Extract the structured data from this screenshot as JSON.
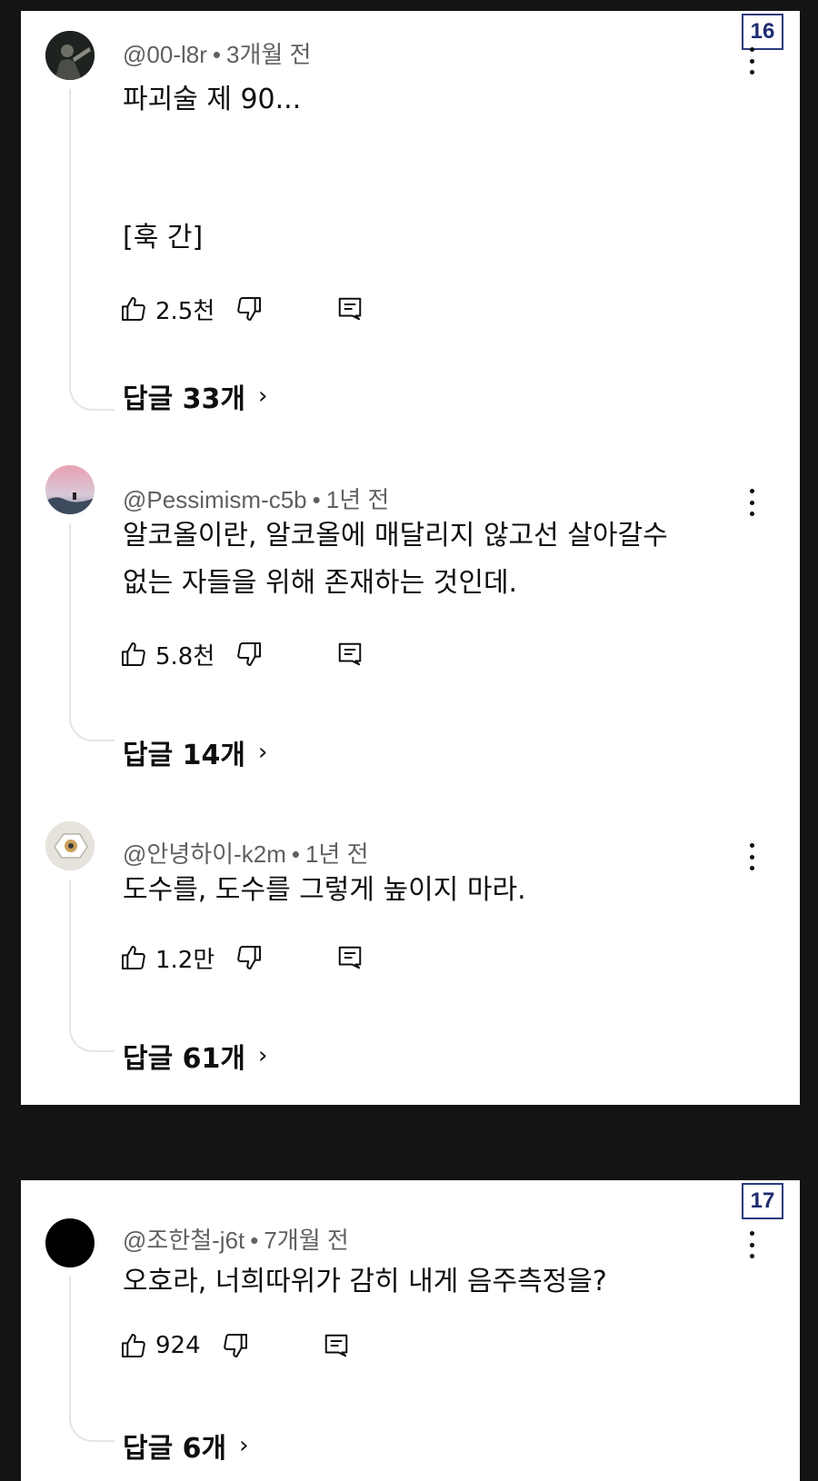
{
  "panels": [
    {
      "badge": "16",
      "comments": [
        {
          "handle": "@00-l8r",
          "time": "3개월 전",
          "lines": [
            "파괴술 제 90...",
            "",
            "[훅 간]"
          ],
          "likes": "2.5천",
          "replies": "답글 33개"
        },
        {
          "handle": "@Pessimism-c5b",
          "time": "1년 전",
          "lines": [
            "알코올이란, 알코올에 매달리지 않고선 살아갈수",
            "없는 자들을 위해 존재하는 것인데."
          ],
          "likes": "5.8천",
          "replies": "답글 14개"
        },
        {
          "handle": "@안녕하이-k2m",
          "time": "1년 전",
          "lines": [
            "도수를, 도수를 그렇게 높이지 마라."
          ],
          "likes": "1.2만",
          "replies": "답글 61개"
        }
      ]
    },
    {
      "badge": "17",
      "comments": [
        {
          "handle": "@조한철-j6t",
          "time": "7개월 전",
          "lines": [
            "오호라, 너희따위가 감히 내게 음주측정을?"
          ],
          "likes": "924",
          "replies": "답글 6개"
        }
      ]
    }
  ],
  "separator": "•",
  "chevron": "›",
  "icons": {
    "like": "thumbs-up-icon",
    "dislike": "thumbs-down-icon",
    "reply": "reply-comment-icon",
    "more": "more-vertical-icon"
  }
}
